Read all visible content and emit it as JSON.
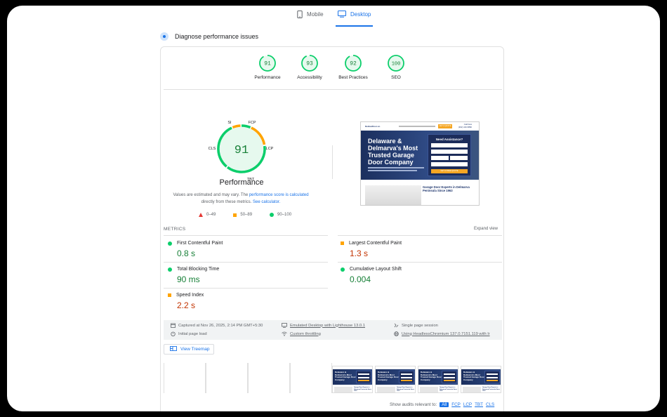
{
  "tabs": [
    {
      "label": "Mobile",
      "icon": "phone-icon"
    },
    {
      "label": "Desktop",
      "icon": "monitor-icon",
      "active": true
    }
  ],
  "diagnose": {
    "title": "Diagnose performance issues"
  },
  "categories": [
    {
      "label": "Performance",
      "score": "91"
    },
    {
      "label": "Accessibility",
      "score": "93"
    },
    {
      "label": "Best Practices",
      "score": "92"
    },
    {
      "label": "SEO",
      "score": "100"
    }
  ],
  "main_gauge": {
    "score": "91",
    "title": "Performance",
    "segments": {
      "si": "SI",
      "fcp": "FCP",
      "lcp": "LCP",
      "tbt": "TBT",
      "cls": "CLS"
    }
  },
  "note": {
    "text1": "Values are estimated and may vary. The ",
    "link1": "performance score is calculated",
    "text2": "directly from these metrics. ",
    "link2": "See calculator."
  },
  "legend": [
    {
      "label": "0–49",
      "color": "#e53935"
    },
    {
      "label": "50–89",
      "color": "#ffa400"
    },
    {
      "label": "90–100",
      "color": "#0cce6b"
    }
  ],
  "screenshot": {
    "logo": "DelmarDoor.co",
    "cta": "GET A QUOTE",
    "call_label": "Call Now",
    "call_number": "(302) 416-5882",
    "headline": "Delaware & Delmarva's Most Trusted Garage Door Company",
    "form_title": "Need Assistance?",
    "form_submit": "GET A FREE QUOTE",
    "lower_text": "Garage Door Experts in Delmarva Peninsula Since 1963"
  },
  "metrics": {
    "heading": "METRICS",
    "expand": "Expand view",
    "items": [
      {
        "name": "First Contentful Paint",
        "value": "0.8 s",
        "status": "good"
      },
      {
        "name": "Largest Contentful Paint",
        "value": "1.3 s",
        "status": "average"
      },
      {
        "name": "Total Blocking Time",
        "value": "90 ms",
        "status": "good"
      },
      {
        "name": "Cumulative Layout Shift",
        "value": "0.004",
        "status": "good"
      },
      {
        "name": "Speed Index",
        "value": "2.2 s",
        "status": "average"
      }
    ]
  },
  "meta": {
    "captured": "Captured at Nov 26, 2025, 2:14 PM GMT+5:30",
    "initial": "Initial page load",
    "emulated": "Emulated Desktop with Lighthouse 13.0.1",
    "throttling": "Custom throttling",
    "session": "Single page session",
    "browser": "Using HeadlessChromium 137.0.7151.119 with lr"
  },
  "treemap": {
    "label": "View Treemap"
  },
  "filmstrip": {
    "headline": "Delaware & Delmarva's Most Trusted Garage Door Company",
    "lower": "Garage Door Experts in Delmarva Peninsula Since 1963"
  },
  "relevant": {
    "label": "Show audits relevant to:",
    "filters": [
      "All",
      "FCP",
      "LCP",
      "TBT",
      "CLS"
    ]
  },
  "colors": {
    "accent": "#1a73e8",
    "pass": "#0cce6b",
    "average": "#ffa400",
    "fail": "#e53935"
  }
}
